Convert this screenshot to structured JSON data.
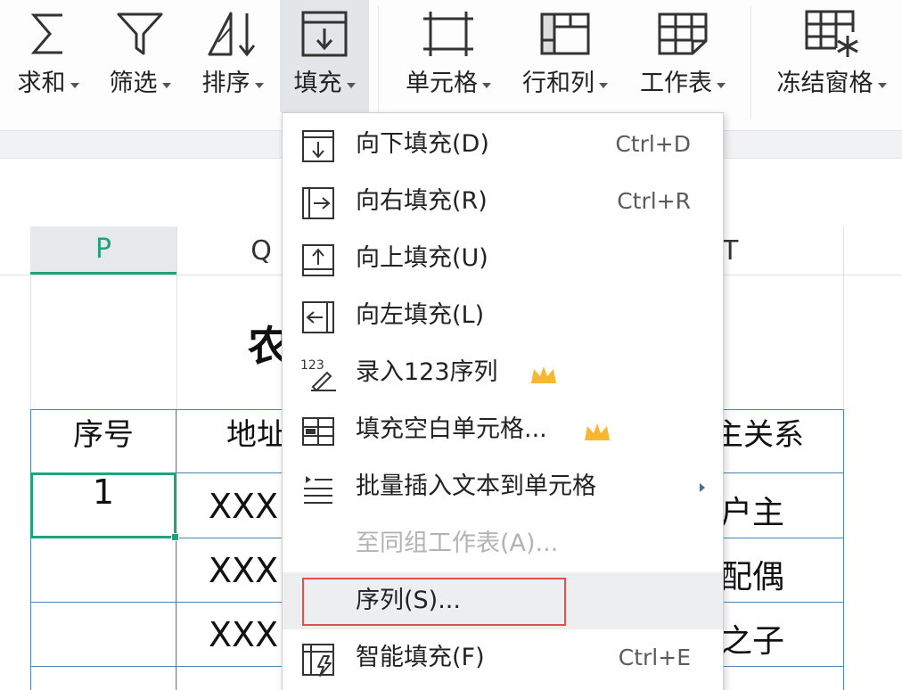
{
  "colors": {
    "accent_green": "#1fa37a",
    "table_border": "#4b86b8",
    "highlight_outline": "#e2504a",
    "crown": "#f7b733"
  },
  "ribbon": {
    "buttons": [
      {
        "label": "求和",
        "icon": "sigma-icon"
      },
      {
        "label": "筛选",
        "icon": "filter-icon"
      },
      {
        "label": "排序",
        "icon": "sort-icon"
      },
      {
        "label": "填充",
        "icon": "fill-icon",
        "active": true
      },
      {
        "label": "单元格",
        "icon": "cell-icon"
      },
      {
        "label": "行和列",
        "icon": "rows-columns-icon"
      },
      {
        "label": "工作表",
        "icon": "worksheet-icon"
      },
      {
        "label": "冻结窗格",
        "icon": "freeze-panes-icon"
      }
    ]
  },
  "sheet": {
    "columns": {
      "p": "P",
      "q": "Q",
      "t": "T"
    },
    "title_fragment": "农",
    "headers": {
      "seq": "序号",
      "addr": "地址",
      "rel": "主关系"
    },
    "active_value": "1",
    "addr_rows": [
      "XXX",
      "XXX",
      "XXX"
    ],
    "rel_rows": [
      "户主",
      "配偶",
      "之子"
    ]
  },
  "fill_menu": {
    "items": [
      {
        "label": "向下填充(D)",
        "shortcut": "Ctrl+D",
        "icon": "fill-down-icon"
      },
      {
        "label": "向右填充(R)",
        "shortcut": "Ctrl+R",
        "icon": "fill-right-icon"
      },
      {
        "label": "向上填充(U)",
        "shortcut": "",
        "icon": "fill-up-icon"
      },
      {
        "label": "向左填充(L)",
        "shortcut": "",
        "icon": "fill-left-icon"
      },
      {
        "label": "录入123序列",
        "shortcut": "",
        "icon": "enter-sequence-icon",
        "premium": true
      },
      {
        "label": "填充空白单元格...",
        "shortcut": "",
        "icon": "fill-blank-cells-icon",
        "premium": true
      },
      {
        "label": "批量插入文本到单元格",
        "shortcut": "",
        "icon": "batch-insert-text-icon",
        "submenu": true
      },
      {
        "label": "至同组工作表(A)...",
        "shortcut": "",
        "icon": "",
        "disabled": true
      },
      {
        "label": "序列(S)...",
        "shortcut": "",
        "icon": "",
        "highlighted": true
      },
      {
        "label": "智能填充(F)",
        "shortcut": "Ctrl+E",
        "icon": "smart-fill-icon"
      }
    ]
  }
}
